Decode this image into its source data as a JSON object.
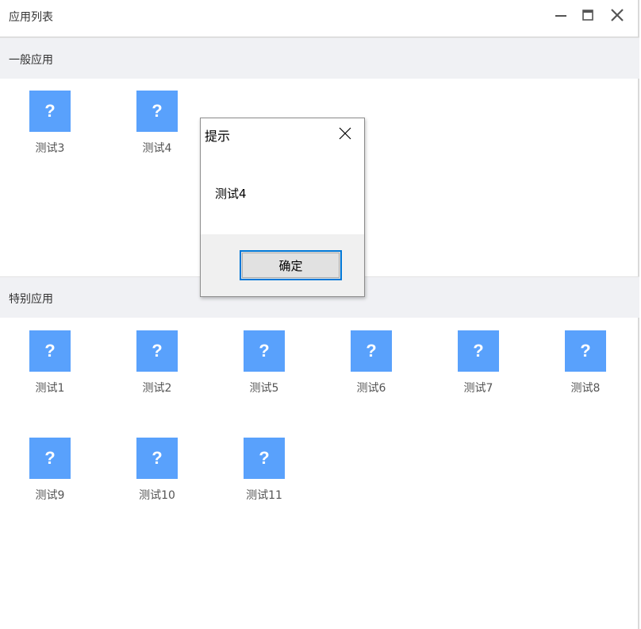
{
  "window": {
    "title": "应用列表",
    "icons": {
      "minimize": "minimize-icon",
      "maximize": "maximize-icon",
      "close": "close-icon"
    }
  },
  "sections": {
    "general": {
      "title": "一般应用",
      "apps": [
        {
          "name": "测试3",
          "icon": "?"
        },
        {
          "name": "测试4",
          "icon": "?"
        }
      ]
    },
    "special": {
      "title": "特别应用",
      "apps": [
        {
          "name": "测试1",
          "icon": "?"
        },
        {
          "name": "测试2",
          "icon": "?"
        },
        {
          "name": "测试5",
          "icon": "?"
        },
        {
          "name": "测试6",
          "icon": "?"
        },
        {
          "name": "测试7",
          "icon": "?"
        },
        {
          "name": "测试8",
          "icon": "?"
        },
        {
          "name": "测试9",
          "icon": "?"
        },
        {
          "name": "测试10",
          "icon": "?"
        },
        {
          "name": "测试11",
          "icon": "?"
        }
      ]
    }
  },
  "dialog": {
    "title": "提示",
    "message": "测试4",
    "ok_label": "确定"
  },
  "colors": {
    "app_icon_bg": "#59a1fc",
    "section_bg": "#f0f1f4",
    "button_focus_border": "#0078d7"
  }
}
